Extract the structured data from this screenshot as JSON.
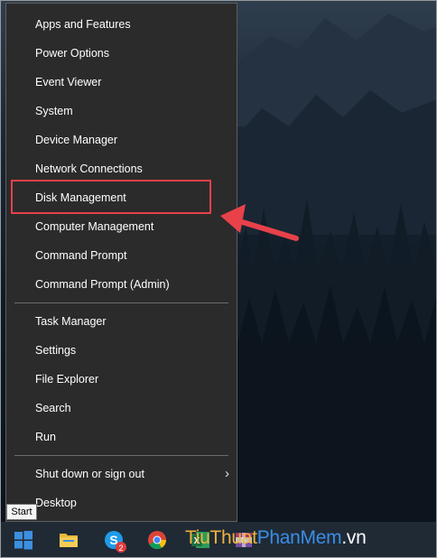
{
  "menu": {
    "group1": [
      {
        "label": "Apps and Features"
      },
      {
        "label": "Power Options"
      },
      {
        "label": "Event Viewer"
      },
      {
        "label": "System"
      },
      {
        "label": "Device Manager"
      },
      {
        "label": "Network Connections"
      },
      {
        "label": "Disk Management"
      },
      {
        "label": "Computer Management"
      },
      {
        "label": "Command Prompt"
      },
      {
        "label": "Command Prompt (Admin)"
      }
    ],
    "group2": [
      {
        "label": "Task Manager"
      },
      {
        "label": "Settings"
      },
      {
        "label": "File Explorer"
      },
      {
        "label": "Search"
      },
      {
        "label": "Run"
      }
    ],
    "group3": [
      {
        "label": "Shut down or sign out",
        "submenu_arrow": "›"
      },
      {
        "label": "Desktop"
      }
    ]
  },
  "highlight": {
    "target": "Disk Management",
    "color": "#e8414a"
  },
  "tooltip": {
    "text": "Start"
  },
  "taskbar": {
    "icons": [
      "windows-start-icon",
      "file-explorer-icon",
      "skype-icon",
      "chrome-icon",
      "excel-icon",
      "winrar-icon"
    ],
    "skype_badge": "2"
  },
  "watermark": {
    "part1": "Tiu",
    "part2": "Thuat",
    "part3": "PhanMem",
    "part4": ".vn"
  }
}
